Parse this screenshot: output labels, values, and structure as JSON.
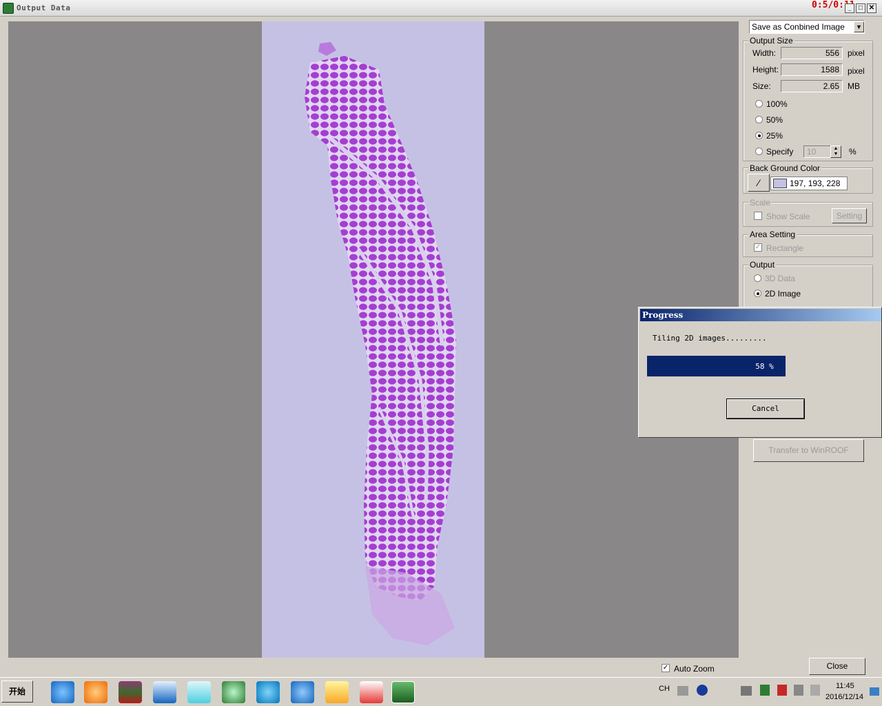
{
  "window": {
    "title": "Output Data",
    "timer": "0:5/0:11",
    "icon": "app-icon"
  },
  "panel": {
    "save_mode": "Save as Conbined Image",
    "output_size": {
      "label": "Output Size",
      "width_label": "Width:",
      "width_value": "556",
      "width_unit": "pixel",
      "height_label": "Height:",
      "height_value": "1588",
      "height_unit": "pixel",
      "size_label": "Size:",
      "size_value": "2.65",
      "size_unit": "MB",
      "options": [
        "100%",
        "50%",
        "25%",
        "Specify"
      ],
      "selected": "25%",
      "specify_value": "10",
      "specify_unit": "%"
    },
    "background": {
      "label": "Back Ground Color",
      "value": "197, 193, 228",
      "swatch": "#c5c1e4"
    },
    "scale": {
      "label": "Scale",
      "show_scale": "Show Scale",
      "setting": "Setting"
    },
    "area": {
      "label": "Area Setting",
      "rectangle": "Rectangle"
    },
    "output": {
      "label": "Output",
      "option_3d": "3D Data",
      "option_2d": "2D Image",
      "selected": "2D Image"
    },
    "transfer": "Transfer to WinROOF",
    "auto_zoom": "Auto Zoom",
    "close": "Close"
  },
  "progress": {
    "title": "Progress",
    "message": "Tiling 2D images.........",
    "percent_text": "58 %",
    "percent": 58,
    "cancel": "Cancel"
  },
  "taskbar": {
    "start": "开始",
    "lang": "CH",
    "time": "11:45",
    "date": "2016/12/14"
  }
}
